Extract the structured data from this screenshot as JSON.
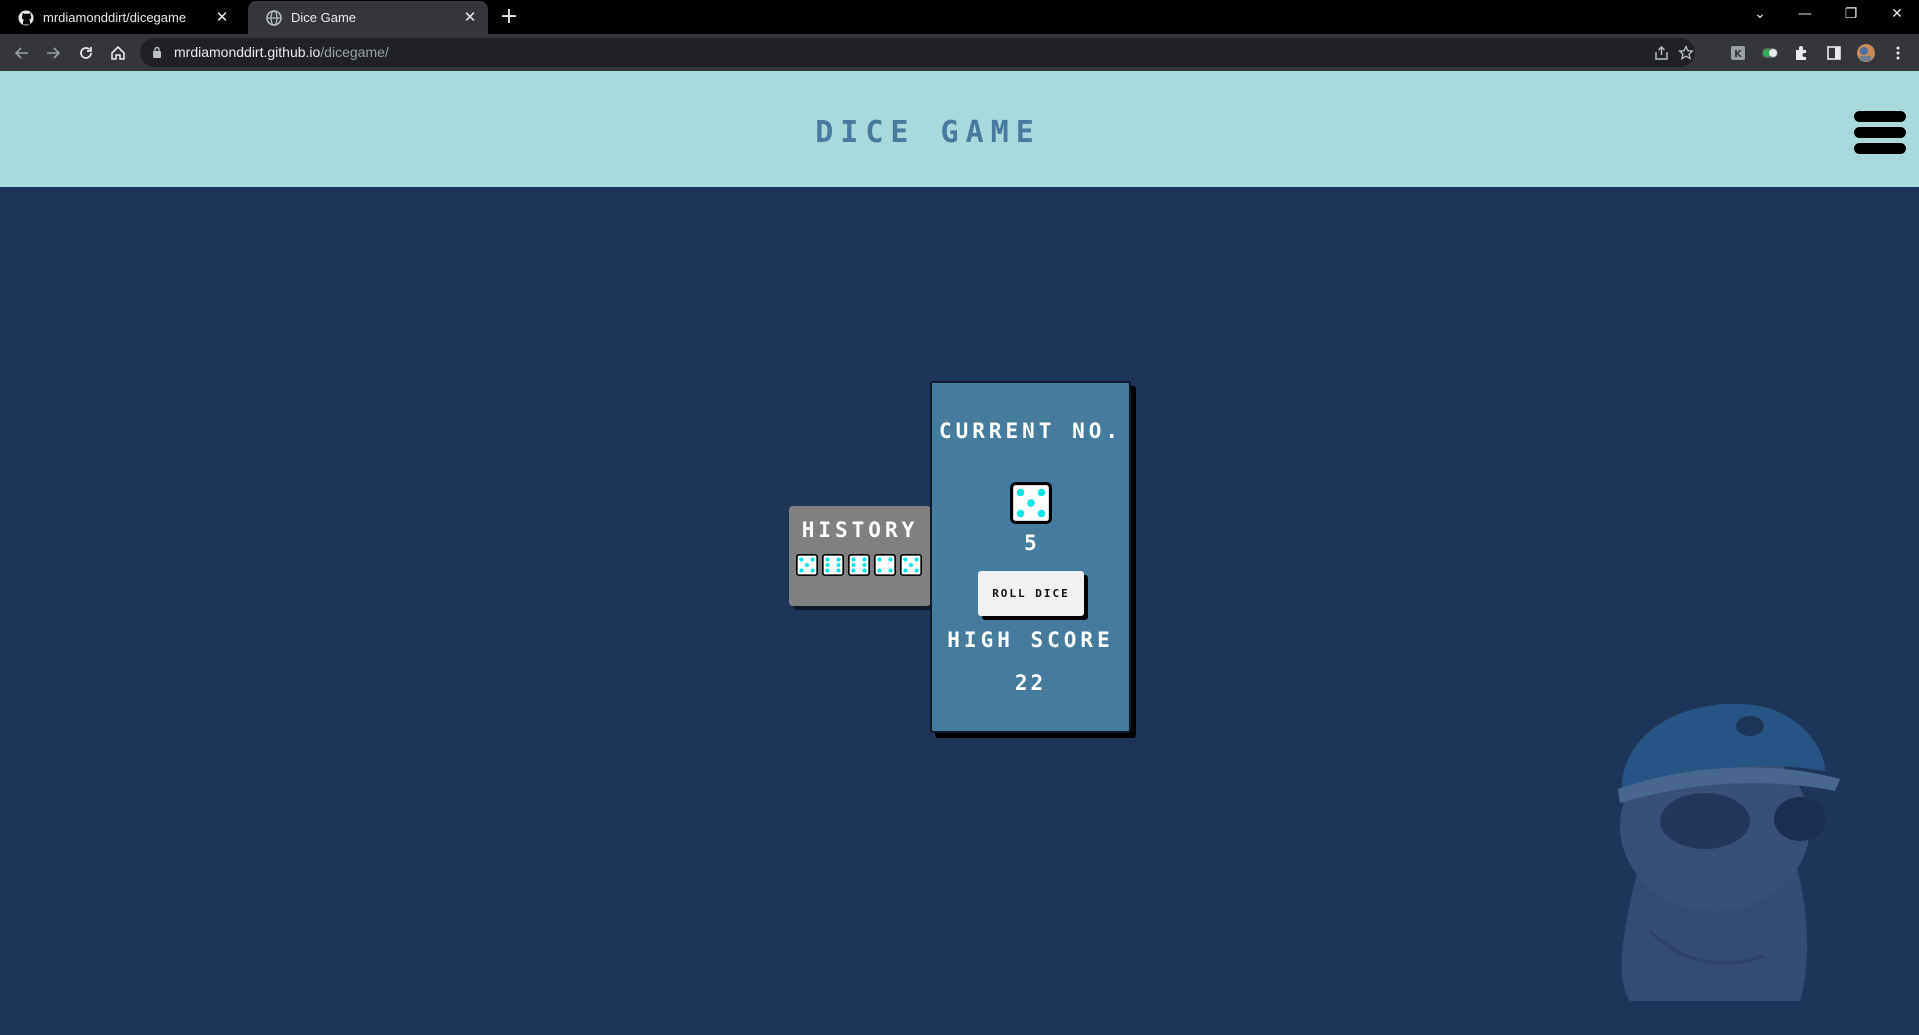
{
  "browser": {
    "tabs": [
      {
        "title": "mrdiamonddirt/dicegame",
        "favicon": "github-icon",
        "active": false
      },
      {
        "title": "Dice Game",
        "favicon": "globe-icon",
        "active": true
      }
    ],
    "new_tab_label": "+",
    "url": {
      "host": "mrdiamonddirt.github.io",
      "path": "/dicegame/"
    }
  },
  "header": {
    "title": "DICE GAME",
    "menu_icon": "hamburger-menu-icon"
  },
  "history": {
    "label": "HISTORY",
    "dice": [
      5,
      6,
      6,
      4,
      5
    ]
  },
  "current": {
    "label": "CURRENT NO.",
    "value": "5"
  },
  "roll_button": {
    "label": "ROLL DICE"
  },
  "high_score": {
    "label": "HIGH SCORE",
    "value": "22"
  },
  "colors": {
    "header_bg": "#a8dadc",
    "title": "#457b9d",
    "page_bg": "#1f3558",
    "card_bg": "#457b9d",
    "history_bg": "#808080",
    "pip": "#00e5e5"
  }
}
